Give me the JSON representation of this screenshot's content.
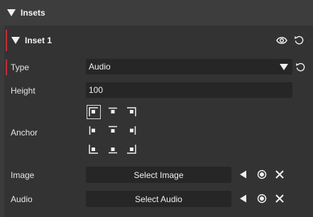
{
  "section": {
    "title": "Insets",
    "icon": "triangle-down-icon"
  },
  "inset": {
    "title": "Inset 1",
    "accent_color": "#c0303a",
    "fields": {
      "type": {
        "label": "Type",
        "value": "Audio"
      },
      "height": {
        "label": "Height",
        "value": "100"
      },
      "anchor": {
        "label": "Anchor",
        "selected": "top-left",
        "options": [
          "top-left",
          "top-center",
          "top-right",
          "middle-left",
          "middle-center",
          "middle-right",
          "bottom-left",
          "bottom-center",
          "bottom-right"
        ]
      },
      "image": {
        "label": "Image",
        "button_label": "Select Image"
      },
      "audio": {
        "label": "Audio",
        "button_label": "Select Audio"
      }
    }
  }
}
